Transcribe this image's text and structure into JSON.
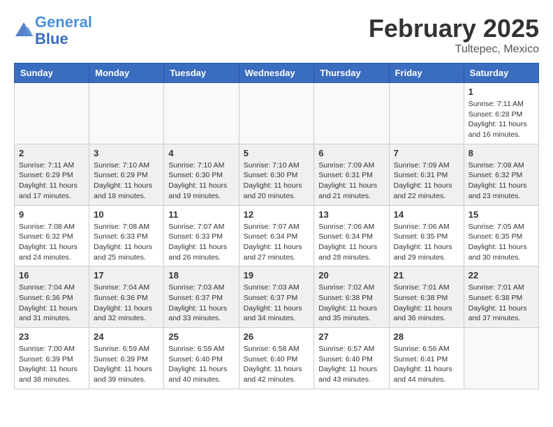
{
  "header": {
    "logo_line1": "General",
    "logo_line2": "Blue",
    "month_title": "February 2025",
    "location": "Tultepec, Mexico"
  },
  "weekdays": [
    "Sunday",
    "Monday",
    "Tuesday",
    "Wednesday",
    "Thursday",
    "Friday",
    "Saturday"
  ],
  "weeks": [
    [
      {
        "day": "",
        "info": ""
      },
      {
        "day": "",
        "info": ""
      },
      {
        "day": "",
        "info": ""
      },
      {
        "day": "",
        "info": ""
      },
      {
        "day": "",
        "info": ""
      },
      {
        "day": "",
        "info": ""
      },
      {
        "day": "1",
        "info": "Sunrise: 7:11 AM\nSunset: 6:28 PM\nDaylight: 11 hours and 16 minutes."
      }
    ],
    [
      {
        "day": "2",
        "info": "Sunrise: 7:11 AM\nSunset: 6:29 PM\nDaylight: 11 hours and 17 minutes."
      },
      {
        "day": "3",
        "info": "Sunrise: 7:10 AM\nSunset: 6:29 PM\nDaylight: 11 hours and 18 minutes."
      },
      {
        "day": "4",
        "info": "Sunrise: 7:10 AM\nSunset: 6:30 PM\nDaylight: 11 hours and 19 minutes."
      },
      {
        "day": "5",
        "info": "Sunrise: 7:10 AM\nSunset: 6:30 PM\nDaylight: 11 hours and 20 minutes."
      },
      {
        "day": "6",
        "info": "Sunrise: 7:09 AM\nSunset: 6:31 PM\nDaylight: 11 hours and 21 minutes."
      },
      {
        "day": "7",
        "info": "Sunrise: 7:09 AM\nSunset: 6:31 PM\nDaylight: 11 hours and 22 minutes."
      },
      {
        "day": "8",
        "info": "Sunrise: 7:08 AM\nSunset: 6:32 PM\nDaylight: 11 hours and 23 minutes."
      }
    ],
    [
      {
        "day": "9",
        "info": "Sunrise: 7:08 AM\nSunset: 6:32 PM\nDaylight: 11 hours and 24 minutes."
      },
      {
        "day": "10",
        "info": "Sunrise: 7:08 AM\nSunset: 6:33 PM\nDaylight: 11 hours and 25 minutes."
      },
      {
        "day": "11",
        "info": "Sunrise: 7:07 AM\nSunset: 6:33 PM\nDaylight: 11 hours and 26 minutes."
      },
      {
        "day": "12",
        "info": "Sunrise: 7:07 AM\nSunset: 6:34 PM\nDaylight: 11 hours and 27 minutes."
      },
      {
        "day": "13",
        "info": "Sunrise: 7:06 AM\nSunset: 6:34 PM\nDaylight: 11 hours and 28 minutes."
      },
      {
        "day": "14",
        "info": "Sunrise: 7:06 AM\nSunset: 6:35 PM\nDaylight: 11 hours and 29 minutes."
      },
      {
        "day": "15",
        "info": "Sunrise: 7:05 AM\nSunset: 6:35 PM\nDaylight: 11 hours and 30 minutes."
      }
    ],
    [
      {
        "day": "16",
        "info": "Sunrise: 7:04 AM\nSunset: 6:36 PM\nDaylight: 11 hours and 31 minutes."
      },
      {
        "day": "17",
        "info": "Sunrise: 7:04 AM\nSunset: 6:36 PM\nDaylight: 11 hours and 32 minutes."
      },
      {
        "day": "18",
        "info": "Sunrise: 7:03 AM\nSunset: 6:37 PM\nDaylight: 11 hours and 33 minutes."
      },
      {
        "day": "19",
        "info": "Sunrise: 7:03 AM\nSunset: 6:37 PM\nDaylight: 11 hours and 34 minutes."
      },
      {
        "day": "20",
        "info": "Sunrise: 7:02 AM\nSunset: 6:38 PM\nDaylight: 11 hours and 35 minutes."
      },
      {
        "day": "21",
        "info": "Sunrise: 7:01 AM\nSunset: 6:38 PM\nDaylight: 11 hours and 36 minutes."
      },
      {
        "day": "22",
        "info": "Sunrise: 7:01 AM\nSunset: 6:38 PM\nDaylight: 11 hours and 37 minutes."
      }
    ],
    [
      {
        "day": "23",
        "info": "Sunrise: 7:00 AM\nSunset: 6:39 PM\nDaylight: 11 hours and 38 minutes."
      },
      {
        "day": "24",
        "info": "Sunrise: 6:59 AM\nSunset: 6:39 PM\nDaylight: 11 hours and 39 minutes."
      },
      {
        "day": "25",
        "info": "Sunrise: 6:59 AM\nSunset: 6:40 PM\nDaylight: 11 hours and 40 minutes."
      },
      {
        "day": "26",
        "info": "Sunrise: 6:58 AM\nSunset: 6:40 PM\nDaylight: 11 hours and 42 minutes."
      },
      {
        "day": "27",
        "info": "Sunrise: 6:57 AM\nSunset: 6:40 PM\nDaylight: 11 hours and 43 minutes."
      },
      {
        "day": "28",
        "info": "Sunrise: 6:56 AM\nSunset: 6:41 PM\nDaylight: 11 hours and 44 minutes."
      },
      {
        "day": "",
        "info": ""
      }
    ]
  ]
}
